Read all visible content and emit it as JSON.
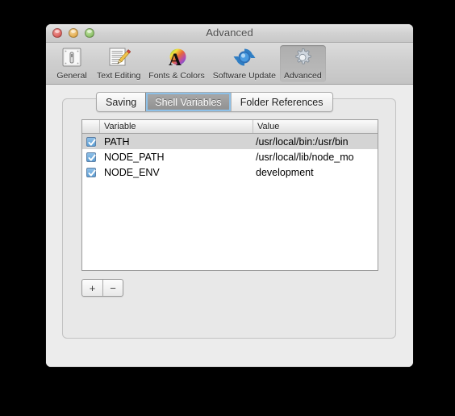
{
  "window": {
    "title": "Advanced",
    "traffic_lights": [
      {
        "name": "close-button",
        "color": "#d9605c"
      },
      {
        "name": "minimize-button",
        "color": "#e3ac4f"
      },
      {
        "name": "zoom-button",
        "color": "#8dc169"
      }
    ]
  },
  "toolbar": {
    "items": [
      {
        "label": "General",
        "icon": "general-icon",
        "selected": false
      },
      {
        "label": "Text Editing",
        "icon": "text-editing-icon",
        "selected": false
      },
      {
        "label": "Fonts & Colors",
        "icon": "fonts-colors-icon",
        "selected": false
      },
      {
        "label": "Software Update",
        "icon": "software-update-icon",
        "selected": false
      },
      {
        "label": "Advanced",
        "icon": "advanced-gear-icon",
        "selected": true
      }
    ]
  },
  "tabs": [
    {
      "label": "Saving",
      "selected": false
    },
    {
      "label": "Shell Variables",
      "selected": true
    },
    {
      "label": "Folder References",
      "selected": false
    }
  ],
  "table": {
    "columns": [
      "",
      "Variable",
      "Value"
    ],
    "rows": [
      {
        "checked": true,
        "variable": "PATH",
        "value": "/usr/local/bin:/usr/bin",
        "selected": true
      },
      {
        "checked": true,
        "variable": "NODE_PATH",
        "value": "/usr/local/lib/node_mo",
        "selected": false
      },
      {
        "checked": true,
        "variable": "NODE_ENV",
        "value": "development",
        "selected": false
      }
    ]
  },
  "controls": {
    "add_label": "+",
    "remove_label": "−"
  },
  "colors": {
    "accent": "#8ec1e8",
    "checkbox": "#5e9fd4",
    "selection": "#d4d4d4",
    "window_bg": "#ececec"
  }
}
